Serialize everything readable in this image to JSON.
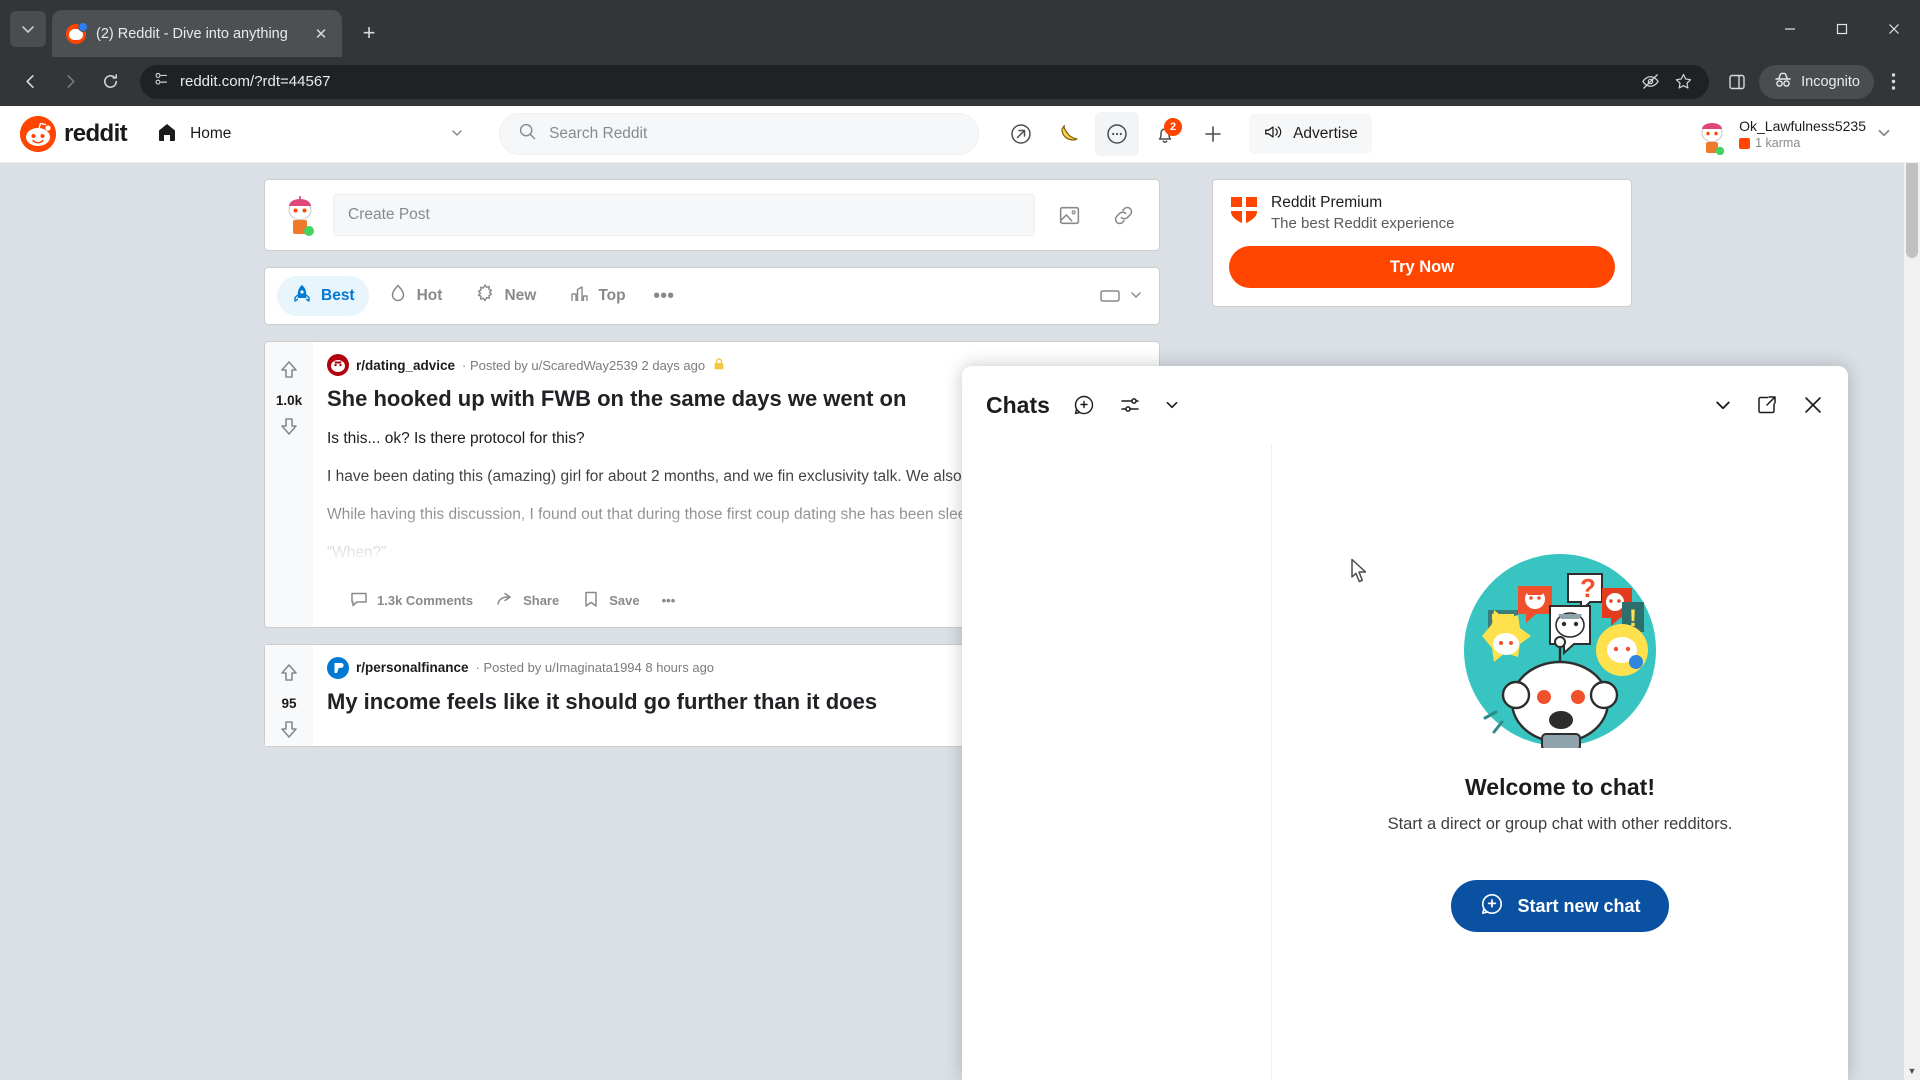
{
  "browser": {
    "tab": {
      "title": "(2) Reddit - Dive into anything",
      "favicon": "reddit-favicon"
    },
    "new_tab_label": "+",
    "tab_close_label": "✕",
    "window": {
      "minimize": "—",
      "maximize": "▢",
      "close": "✕"
    },
    "toolbar": {
      "back": "←",
      "forward": "→",
      "reload": "⟳",
      "url": "reddit.com/?rdt=44567",
      "site_info_icon": "page-info-icon",
      "icons": [
        "eye-off-icon",
        "star-icon"
      ],
      "side_panel_icon": "side-panel-icon",
      "incognito_label": "Incognito",
      "menu_icon": "kebab-menu-icon"
    }
  },
  "reddit_header": {
    "logo_text": "reddit",
    "home_label": "Home",
    "home_chevron": "⌄",
    "search_placeholder": "Search Reddit",
    "actions": [
      {
        "name": "popular-icon",
        "glyph": "↗"
      },
      {
        "name": "banana-icon",
        "glyph": "🍌"
      },
      {
        "name": "chat-icon",
        "glyph": "…"
      },
      {
        "name": "notifications-icon",
        "glyph": "🔔",
        "badge": "2"
      },
      {
        "name": "create-icon",
        "glyph": "+"
      }
    ],
    "advertise_label": "Advertise",
    "user": {
      "name": "Ok_Lawfulness5235",
      "karma": "1 karma",
      "chevron": "⌄"
    }
  },
  "create_post": {
    "placeholder": "Create Post",
    "image_icon": "image-icon",
    "link_icon": "link-icon"
  },
  "sort_bar": {
    "items": [
      {
        "label": "Best",
        "icon": "rocket-icon",
        "active": true
      },
      {
        "label": "Hot",
        "icon": "flame-icon",
        "active": false
      },
      {
        "label": "New",
        "icon": "sparkle-icon",
        "active": false
      },
      {
        "label": "Top",
        "icon": "chart-icon",
        "active": false
      }
    ],
    "more": "•••",
    "view_chevron": "⌄"
  },
  "posts": [
    {
      "subreddit": "r/dating_advice",
      "posted_by": "· Posted by u/ScaredWay2539 2 days ago",
      "locked_icon": "lock-icon",
      "score": "1.0k",
      "title": "She hooked up with FWB on the same days we went on",
      "paragraphs": [
        "Is this... ok? Is there protocol for this?",
        "I have been dating this (amazing) girl for about 2 months, and we fin exclusivity talk. We also have not had sex yet, since she wanted to wa “really likes me” and was scared of getting hurt. Totally reasonable.",
        "While having this discussion, I found out that during those first coup dating she has been sleeping with a FWB. I was surprised that she w this whole time, while still having sex with another guy. However, tha get past because we weren't exclusive yet—but upon hearing it I was lol, and an unexpected question escaped my mouth:",
        "“When?”"
      ],
      "actions": [
        {
          "label": "1.3k Comments",
          "icon": "comment-icon"
        },
        {
          "label": "Share",
          "icon": "share-icon"
        },
        {
          "label": "Save",
          "icon": "bookmark-icon"
        },
        {
          "label": "•••",
          "icon": "more-icon"
        }
      ]
    },
    {
      "subreddit": "r/personalfinance",
      "posted_by": "· Posted by u/Imaginata1994 8 hours ago",
      "score": "95",
      "title": "My income feels like it should go further than it does"
    }
  ],
  "premium": {
    "title": "Reddit Premium",
    "subtitle": "The best Reddit experience",
    "cta": "Try Now",
    "shield_icon": "shield-icon"
  },
  "chat": {
    "title": "Chats",
    "new_chat_icon": "new-chat-icon",
    "filter_icon": "filter-icon",
    "filter_chevron": "⌄",
    "minimize_icon": "⌄",
    "popout_icon": "pop-out-icon",
    "close_icon": "✕",
    "empty_title": "Welcome to chat!",
    "empty_subtitle": "Start a direct or group chat with other redditors.",
    "start_button": "Start new chat",
    "illustration": "snoo-chat-illustration"
  },
  "colors": {
    "reddit_orange": "#FF4500",
    "reddit_blue": "#0079D3",
    "chat_button_blue": "#0B51A1",
    "page_bg": "#DAE0E6",
    "chrome_bg": "#333639",
    "teal_illustration": "#38C4C0"
  }
}
